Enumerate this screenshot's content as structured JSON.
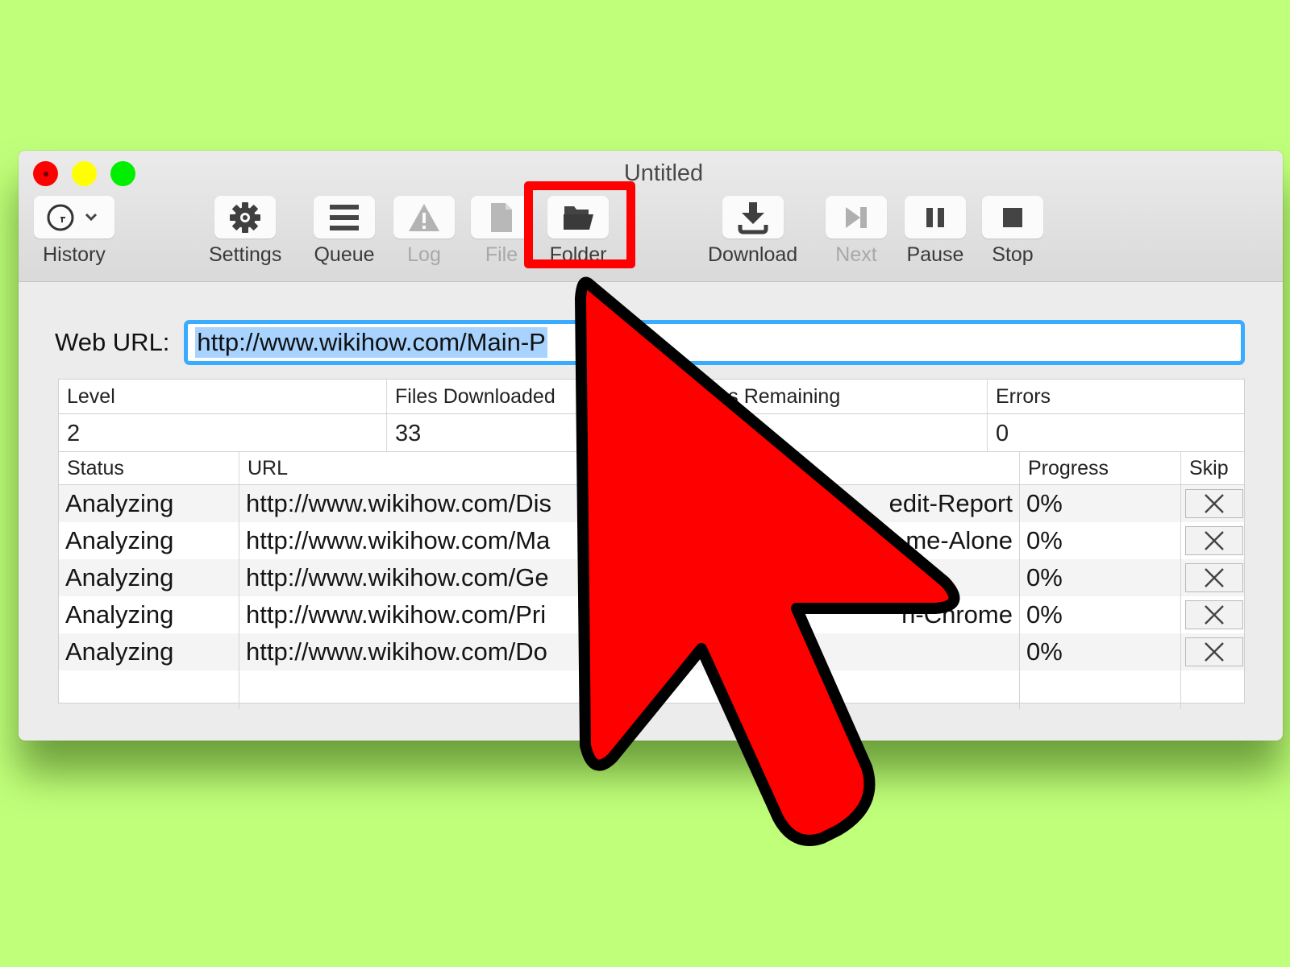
{
  "window": {
    "title": "Untitled",
    "traffic_lights": [
      "close",
      "minimize",
      "zoom"
    ]
  },
  "toolbar": {
    "items": [
      {
        "label": "History",
        "icon": "clock-icon",
        "has_dropdown": true,
        "enabled": true
      },
      {
        "label": "Settings",
        "icon": "gear-icon",
        "enabled": true
      },
      {
        "label": "Queue",
        "icon": "list-icon",
        "enabled": true
      },
      {
        "label": "Log",
        "icon": "warning-icon",
        "enabled": false
      },
      {
        "label": "File",
        "icon": "file-icon",
        "enabled": false
      },
      {
        "label": "Folder",
        "icon": "folder-icon",
        "enabled": true,
        "highlighted": true
      },
      {
        "label": "Download",
        "icon": "download-icon",
        "enabled": true
      },
      {
        "label": "Next",
        "icon": "skip-forward-icon",
        "enabled": false
      },
      {
        "label": "Pause",
        "icon": "pause-icon",
        "enabled": true
      },
      {
        "label": "Stop",
        "icon": "stop-icon",
        "enabled": true
      }
    ]
  },
  "url_bar": {
    "label": "Web URL:",
    "value": "http://www.wikihow.com/Main-P"
  },
  "stats": {
    "headers": [
      "Level",
      "Files Downloaded",
      "Files Remaining",
      "Errors"
    ],
    "values": [
      "2",
      "33",
      "",
      "0"
    ]
  },
  "queue": {
    "headers": [
      "Status",
      "URL",
      "Progress",
      "Skip"
    ],
    "rows": [
      {
        "status": "Analyzing",
        "url_start": "http://www.wikihow.com/Dis",
        "url_end": "edit-Report",
        "progress": "0%"
      },
      {
        "status": "Analyzing",
        "url_start": "http://www.wikihow.com/Ma",
        "url_end": "me-Alone",
        "progress": "0%"
      },
      {
        "status": "Analyzing",
        "url_start": "http://www.wikihow.com/Ge",
        "url_end": "",
        "progress": "0%"
      },
      {
        "status": "Analyzing",
        "url_start": "http://www.wikihow.com/Pri",
        "url_end": "n-Chrome",
        "progress": "0%"
      },
      {
        "status": "Analyzing",
        "url_start": "http://www.wikihow.com/Do",
        "url_end": "",
        "progress": "0%"
      }
    ]
  },
  "annotation": {
    "highlight_target": "Folder",
    "color": "#fe0000"
  }
}
